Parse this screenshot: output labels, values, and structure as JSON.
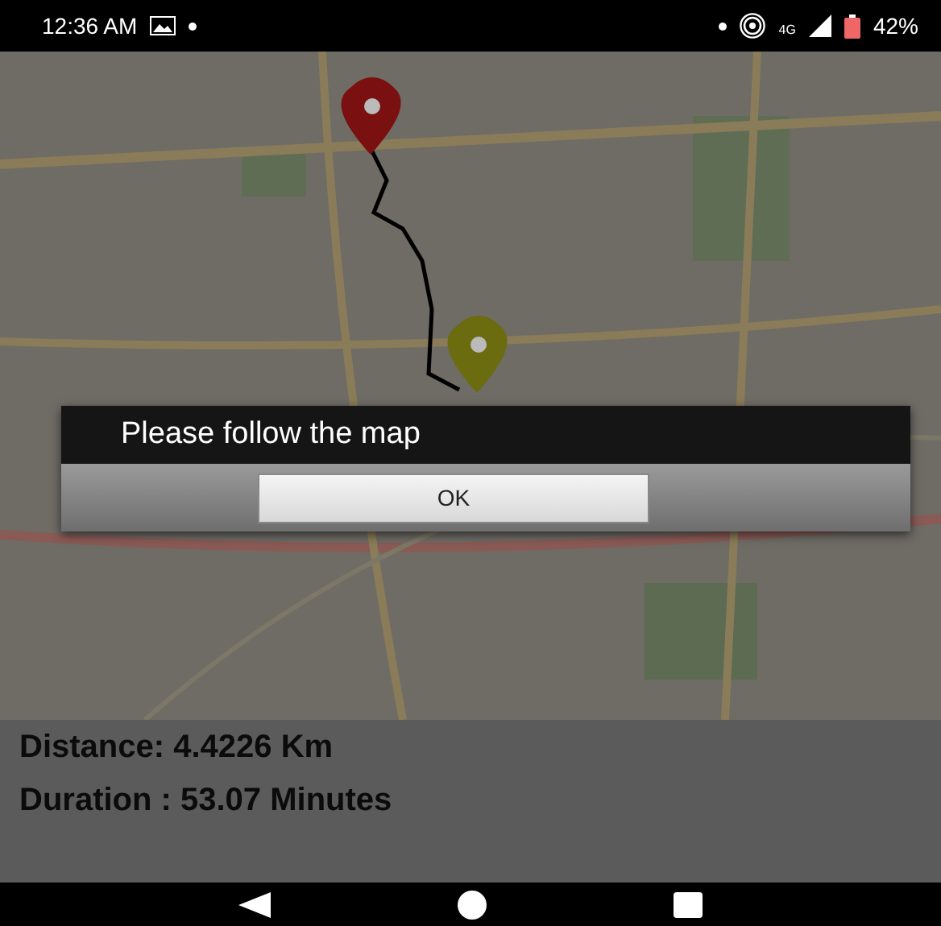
{
  "status_bar": {
    "time": "12:36 AM",
    "network": "4G",
    "battery": "42%"
  },
  "dialog": {
    "message": "Please follow the map",
    "buttons": [
      {
        "label": "OK"
      }
    ]
  },
  "route_info": [
    {
      "text": "Distance: 4.4226 Km"
    },
    {
      "text": "Duration : 53.07 Minutes"
    }
  ]
}
